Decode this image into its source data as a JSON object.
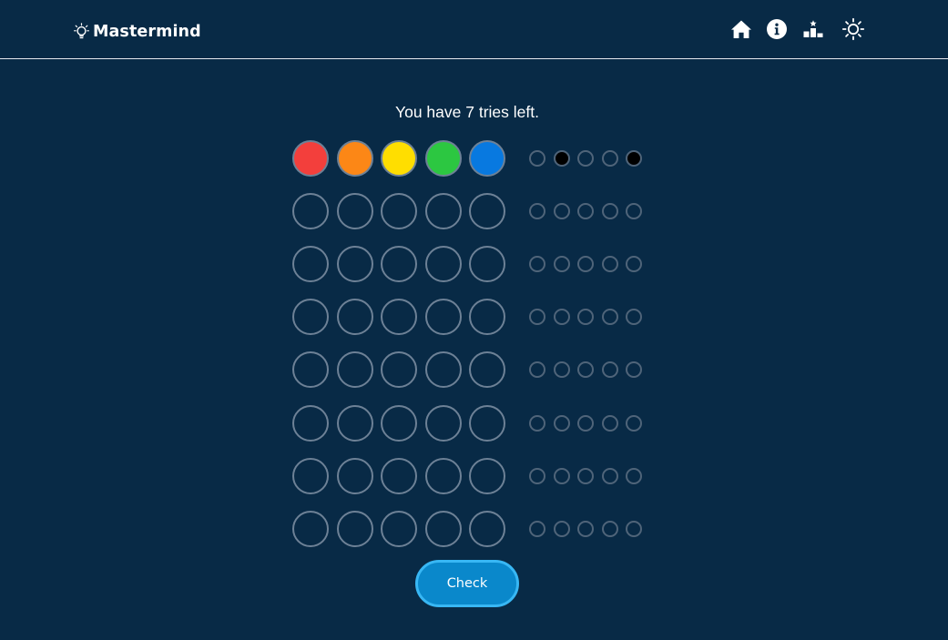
{
  "app": {
    "title": "Mastermind"
  },
  "nav": [
    {
      "name": "home-icon",
      "icon": "home"
    },
    {
      "name": "info-icon",
      "icon": "info"
    },
    {
      "name": "leaderboard-icon",
      "icon": "podium"
    },
    {
      "name": "theme-toggle-icon",
      "icon": "sun"
    }
  ],
  "status": {
    "text": "You have 7 tries left."
  },
  "colors": {
    "background": "#082a46",
    "empty_peg_border": "#6d8196",
    "hint_border": "#4f6479",
    "hint_black": "#000000",
    "button": "#0a88cb",
    "button_border": "#38b7f4"
  },
  "board": {
    "rows": [
      {
        "pegs": [
          "#f33f3c",
          "#fc8716",
          "#ffde00",
          "#2cc741",
          "#0879e0"
        ],
        "hints": [
          "empty",
          "black",
          "empty",
          "empty",
          "black"
        ]
      },
      {
        "pegs": [
          null,
          null,
          null,
          null,
          null
        ],
        "hints": [
          "empty",
          "empty",
          "empty",
          "empty",
          "empty"
        ]
      },
      {
        "pegs": [
          null,
          null,
          null,
          null,
          null
        ],
        "hints": [
          "empty",
          "empty",
          "empty",
          "empty",
          "empty"
        ]
      },
      {
        "pegs": [
          null,
          null,
          null,
          null,
          null
        ],
        "hints": [
          "empty",
          "empty",
          "empty",
          "empty",
          "empty"
        ]
      },
      {
        "pegs": [
          null,
          null,
          null,
          null,
          null
        ],
        "hints": [
          "empty",
          "empty",
          "empty",
          "empty",
          "empty"
        ]
      },
      {
        "pegs": [
          null,
          null,
          null,
          null,
          null
        ],
        "hints": [
          "empty",
          "empty",
          "empty",
          "empty",
          "empty"
        ]
      },
      {
        "pegs": [
          null,
          null,
          null,
          null,
          null
        ],
        "hints": [
          "empty",
          "empty",
          "empty",
          "empty",
          "empty"
        ]
      },
      {
        "pegs": [
          null,
          null,
          null,
          null,
          null
        ],
        "hints": [
          "empty",
          "empty",
          "empty",
          "empty",
          "empty"
        ]
      }
    ]
  },
  "actions": {
    "check_label": "Check"
  }
}
